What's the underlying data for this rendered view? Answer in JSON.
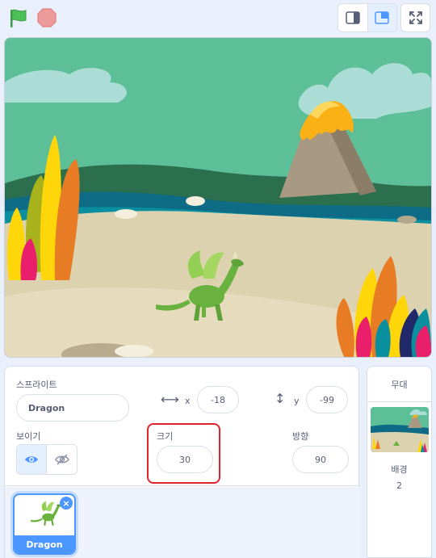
{
  "toolbar": {
    "green_flag_icon": "green-flag-icon",
    "stop_icon": "stop-icon",
    "colors": {
      "flag": "#4cbf56",
      "stop": "#ec5959",
      "accent": "#4c97ff",
      "highlight": "#e0242c"
    }
  },
  "sprite": {
    "section_label": "스프라이트",
    "name": "Dragon",
    "x_label": "x",
    "x_value": "-18",
    "y_label": "y",
    "y_value": "-99",
    "show_label": "보이기",
    "size_label": "크기",
    "size_value": "30",
    "direction_label": "방향",
    "direction_value": "90"
  },
  "sprite_list": [
    {
      "name": "Dragon",
      "selected": true
    }
  ],
  "stage_panel": {
    "title": "무대",
    "backdrop_label": "배경",
    "backdrop_count": "2"
  }
}
